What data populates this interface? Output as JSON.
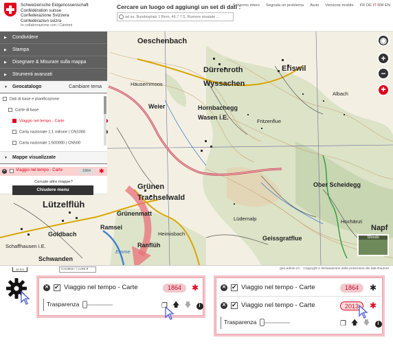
{
  "header": {
    "logo_lines": [
      "Schweizerische Eidgenossenschaft",
      "Confédération suisse",
      "Confederazione Svizzera",
      "Confederaziun svizra"
    ],
    "logo_sub": "In collaborazione con i Cantoni",
    "search_label": "Cercare un luogo od aggiungi un set di dati :",
    "search_placeholder": "ad es. Bundesplatz 1 Bern, 46.7 7.5, Rumore stradale ...",
    "links": [
      "Schermo intero",
      "Segnala un problema",
      "Aiuto",
      "Versione mobile"
    ],
    "languages": [
      "FR",
      "DE",
      "IT",
      "RM",
      "EN"
    ],
    "active_language": "IT"
  },
  "panel": {
    "accordion": [
      "Condividere",
      "Stampa",
      "Disegnare & Misurare sulla mappa",
      "Strumenti avanzati"
    ],
    "catalog_title": "Geocatalogo",
    "catalog_action": "Cambiare tema",
    "tree": [
      "Dati di base e pianificazione",
      "Carte di base",
      "Viaggio nel tempo - Carte",
      "Carta nazionale 1:1 milione | CN1000",
      "Carta nazionale 1:500000 | CN500"
    ],
    "layers_title": "Mappe visualizzate",
    "layer_label": "Viaggio nel tempo - Carte",
    "layer_year": "1864",
    "more_maps": "Cercate altre mappe?",
    "close_menu": "Chiudere menu"
  },
  "map": {
    "places": [
      "Oeschenbach",
      "Dürrenroth",
      "Wyssachen",
      "Eriswil",
      "Weier",
      "Hornbachegg",
      "Wasen i.E.",
      "Grünen",
      "Trachselwald",
      "Lützelflüh",
      "Grünenmatt",
      "Ramsei",
      "Goldbach",
      "Ranflüh",
      "Schaffhausen i.E.",
      "Schwanden",
      "Häusernmoos",
      "Ober Scheidegg",
      "Hochänzi",
      "Geissgratflue",
      "Lüdernalp",
      "Albach",
      "Fritzenflue",
      "Heimisbach",
      "Napf",
      "Emme"
    ],
    "basemap_label": "Sfondo",
    "scale_label": "10 km",
    "projection": "CH1903+ / LV95",
    "footer_site": "geo.admin.ch",
    "footer_text": "Copyright e dichiarazione della protezione dei dati d'autore",
    "controls": [
      "location-button",
      "zoom-in-button",
      "zoom-out-button",
      "swiss-button"
    ]
  },
  "inset_left": {
    "layer_label": "Viaggio nel tempo - Carte",
    "year": "1864",
    "opacity_label": "Trasparenza"
  },
  "inset_right": {
    "rows": [
      {
        "layer_label": "Viaggio nel tempo - Carte",
        "year": "1864"
      },
      {
        "layer_label": "Viaggio nel tempo - Carte",
        "year": "2013"
      }
    ],
    "opacity_label": "Trasparenza"
  },
  "colors": {
    "accent": "#e3001b",
    "panel_dark": "#606060",
    "highlight": "#f9d2d2"
  }
}
